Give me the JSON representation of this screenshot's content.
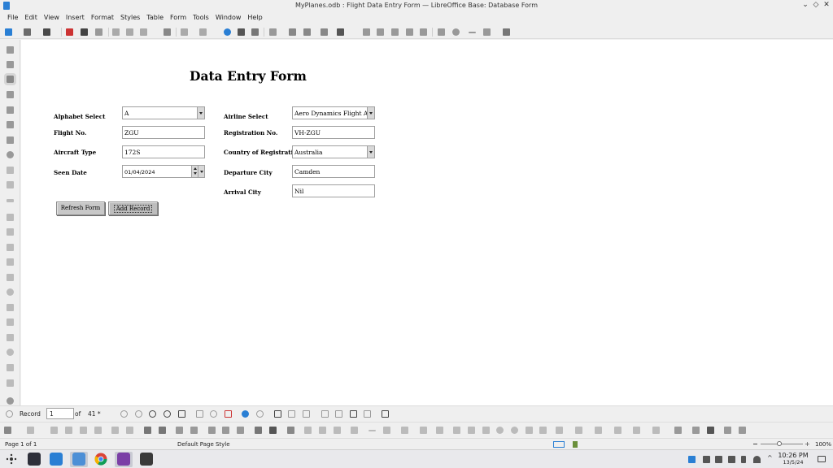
{
  "window": {
    "title": "MyPlanes.odb : Flight Data Entry Form — LibreOffice Base: Database Form",
    "controls": [
      "⌄",
      "◇",
      "✕"
    ]
  },
  "menu": [
    "File",
    "Edit",
    "View",
    "Insert",
    "Format",
    "Styles",
    "Table",
    "Form",
    "Tools",
    "Window",
    "Help"
  ],
  "form": {
    "title": "Data Entry Form",
    "labels": {
      "alphabet": "Alphabet Select",
      "flight": "Flight No.",
      "aircraft": "Aircraft Type",
      "seen": "Seen Date",
      "airline": "Airline Select",
      "registration": "Registration No.",
      "country": "Country of Registration",
      "departure": "Departure City",
      "arrival": "Arrival City"
    },
    "values": {
      "alphabet": "A",
      "flight": "ZGU",
      "aircraft": "172S",
      "seen": "01/04/2024",
      "airline": "Aero Dynamics Flight Aca",
      "registration": "VH-ZGU",
      "country": "Australia",
      "departure": "Camden",
      "arrival": "Nil"
    },
    "buttons": {
      "refresh": "Refresh Form",
      "add": "Add Record"
    }
  },
  "navigation": {
    "record_label": "Record",
    "record_value": "1",
    "of_label": "of",
    "total": "41 *"
  },
  "status": {
    "page": "Page 1 of 1",
    "style": "Default Page Style",
    "zoom": "100%"
  },
  "clock": {
    "time": "10:26 PM",
    "date": "13/5/24"
  }
}
